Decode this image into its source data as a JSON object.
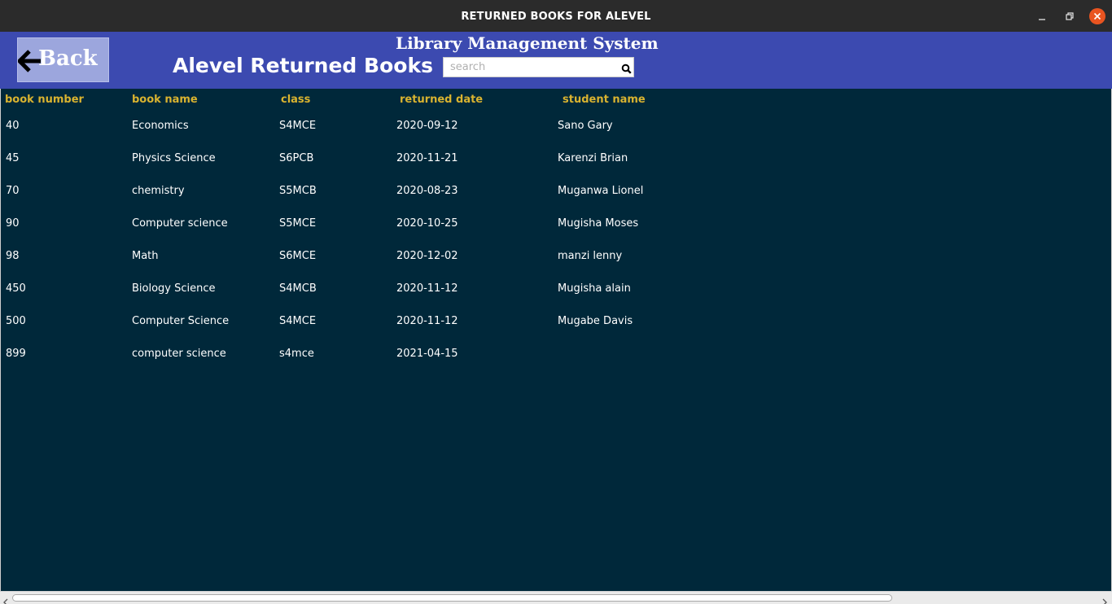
{
  "window": {
    "title": "RETURNED BOOKS FOR ALEVEL",
    "controls": [
      "minimize-icon",
      "maximize-icon",
      "close-icon"
    ],
    "close_color": "#e95420"
  },
  "header": {
    "back_label": "Back",
    "system_title": "Library Management System",
    "page_title": "Alevel Returned Books",
    "search_placeholder": "search",
    "search_value": "",
    "background": "#3c4ab0"
  },
  "table": {
    "header_color": "#d9b330",
    "background": "#00283a",
    "columns": [
      "book number",
      "book name",
      "class",
      "returned date",
      "student name"
    ],
    "rows": [
      [
        "40",
        "Economics",
        "S4MCE",
        "2020-09-12",
        "Sano Gary"
      ],
      [
        "45",
        "Physics Science",
        "S6PCB",
        "2020-11-21",
        "Karenzi Brian"
      ],
      [
        "70",
        "chemistry",
        "S5MCB",
        "2020-08-23",
        "Muganwa Lionel"
      ],
      [
        "90",
        "Computer science",
        "S5MCE",
        "2020-10-25",
        "Mugisha Moses"
      ],
      [
        "98",
        "Math",
        "S6MCE",
        "2020-12-02",
        "manzi lenny"
      ],
      [
        "450",
        "Biology Science",
        "S4MCB",
        "2020-11-12",
        "Mugisha alain"
      ],
      [
        "500",
        "Computer Science",
        "S4MCE",
        "2020-11-12",
        "Mugabe Davis"
      ],
      [
        "899",
        "computer science",
        "s4mce",
        "2021-04-15",
        ""
      ]
    ]
  }
}
